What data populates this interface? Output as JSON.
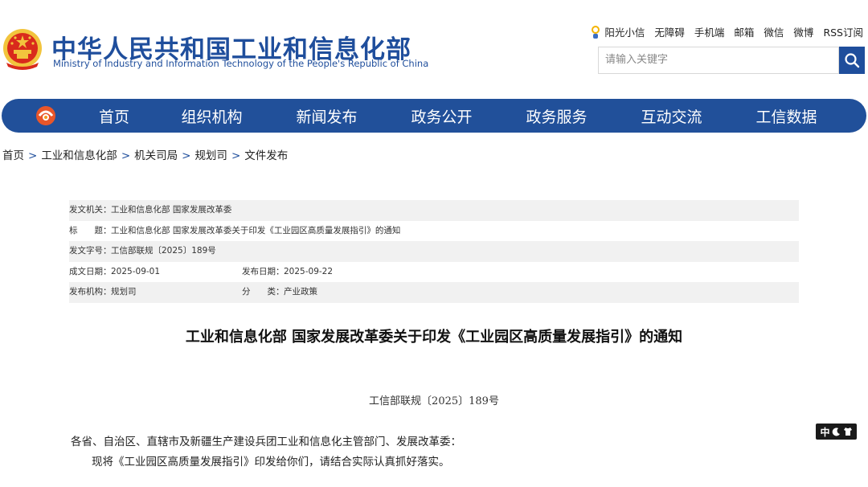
{
  "header": {
    "title_cn": "中华人民共和国工业和信息化部",
    "title_en": "Ministry of Industry and Information Technology of the People's Republic of China",
    "links": [
      "阳光小信",
      "无障碍",
      "手机端",
      "邮箱",
      "微信",
      "微博",
      "RSS订阅"
    ],
    "search_placeholder": "请输入关键字"
  },
  "nav": {
    "items": [
      "首页",
      "组织机构",
      "新闻发布",
      "政务公开",
      "政务服务",
      "互动交流",
      "工信数据"
    ]
  },
  "breadcrumb": [
    "首页",
    "工业和信息化部",
    "机关司局",
    "规划司",
    "文件发布"
  ],
  "meta": {
    "issuer_label": "发文机关：",
    "issuer": "工业和信息化部 国家发展改革委",
    "title_label": "标　　题：",
    "title": "工业和信息化部 国家发展改革委关于印发《工业园区高质量发展指引》的通知",
    "docno_label": "发文字号：",
    "docno": "工信部联规〔2025〕189号",
    "created_label": "成文日期：",
    "created": "2025-09-01",
    "published_label": "发布日期：",
    "published": "2025-09-22",
    "org_label": "发布机构：",
    "org": "规划司",
    "category_label": "分　　类：",
    "category": "产业政策"
  },
  "article": {
    "title": "工业和信息化部 国家发展改革委关于印发《工业园区高质量发展指引》的通知",
    "number": "工信部联规〔2025〕189号",
    "para1": "各省、自治区、直辖市及新疆生产建设兵团工业和信息化主管部门、发展改革委：",
    "para2": "现将《工业园区高质量发展指引》印发给你们，请结合实际认真抓好落实。"
  },
  "widget": {
    "label": "中"
  },
  "colors": {
    "brand_blue": "#21509a",
    "emblem_red": "#d92a1c",
    "emblem_gold": "#f2c43d"
  }
}
